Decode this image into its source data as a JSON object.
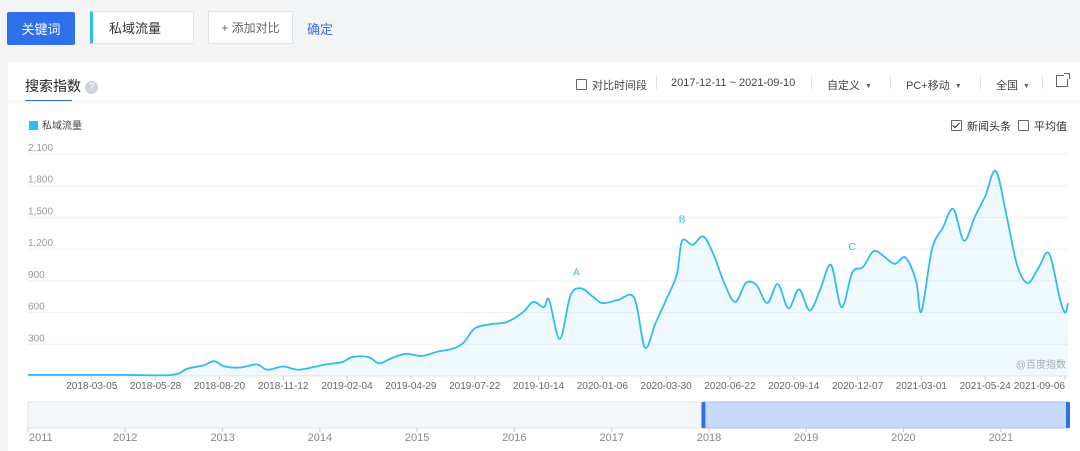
{
  "toolbar": {
    "keyword_button": "关键词",
    "keyword_value": "私域流量",
    "add_compare": "+ 添加对比",
    "confirm": "确定"
  },
  "panel": {
    "title": "搜索指数",
    "help_icon": "question-circle-icon",
    "compare_period_label": "对比时间段",
    "compare_period_checked": false,
    "date_range": "2017-12-11 ~ 2021-09-10",
    "custom_label": "自定义",
    "device_label": "PC+移动",
    "region_label": "全国",
    "export_icon": "external-link-icon",
    "news_headline_label": "新闻头条",
    "news_headline_checked": true,
    "average_label": "平均值",
    "average_checked": false,
    "watermark": "@百度指数"
  },
  "colors": {
    "accent": "#2f6fe9",
    "series": "#2ebdf3",
    "link": "#3370ff"
  },
  "chart_data": {
    "type": "area",
    "title": "",
    "xlabel": "",
    "ylabel": "",
    "ylim": [
      0,
      2100
    ],
    "y_ticks": [
      300,
      600,
      900,
      1200,
      1500,
      1800,
      2100
    ],
    "y_tick_labels": [
      "300",
      "600",
      "900",
      "1,200",
      "1,500",
      "1,800",
      "2,100"
    ],
    "x_range": [
      "2017-12-11",
      "2021-09-10"
    ],
    "x_tick_labels": [
      "2018-03-05",
      "2018-05-28",
      "2018-08-20",
      "2018-11-12",
      "2019-02-04",
      "2019-04-29",
      "2019-07-22",
      "2019-10-14",
      "2020-01-06",
      "2020-03-30",
      "2020-06-22",
      "2020-09-14",
      "2020-12-07",
      "2021-03-01",
      "2021-05-24",
      "2021-09-06"
    ],
    "legend": [
      "私域流量"
    ],
    "legend_position": "top-left",
    "grid": true,
    "annotations": [
      {
        "label": "A",
        "x": "2019-12-03",
        "y": 820
      },
      {
        "label": "B",
        "x": "2020-04-20",
        "y": 1320
      },
      {
        "label": "C",
        "x": "2020-11-30",
        "y": 1060
      }
    ],
    "series": [
      {
        "name": "私域流量",
        "points": [
          [
            "2017-12-11",
            10
          ],
          [
            "2018-02-12",
            10
          ],
          [
            "2018-04-16",
            10
          ],
          [
            "2018-06-18",
            10
          ],
          [
            "2018-07-09",
            70
          ],
          [
            "2018-07-30",
            100
          ],
          [
            "2018-08-13",
            140
          ],
          [
            "2018-08-27",
            90
          ],
          [
            "2018-09-17",
            80
          ],
          [
            "2018-10-08",
            110
          ],
          [
            "2018-10-22",
            60
          ],
          [
            "2018-11-12",
            90
          ],
          [
            "2018-12-03",
            60
          ],
          [
            "2019-01-07",
            110
          ],
          [
            "2019-01-28",
            130
          ],
          [
            "2019-02-11",
            180
          ],
          [
            "2019-03-04",
            180
          ],
          [
            "2019-03-18",
            120
          ],
          [
            "2019-04-01",
            160
          ],
          [
            "2019-04-22",
            210
          ],
          [
            "2019-05-13",
            190
          ],
          [
            "2019-06-03",
            230
          ],
          [
            "2019-06-24",
            260
          ],
          [
            "2019-07-08",
            320
          ],
          [
            "2019-07-22",
            450
          ],
          [
            "2019-08-12",
            490
          ],
          [
            "2019-09-02",
            510
          ],
          [
            "2019-09-23",
            600
          ],
          [
            "2019-10-07",
            700
          ],
          [
            "2019-10-21",
            650
          ],
          [
            "2019-10-28",
            720
          ],
          [
            "2019-11-11",
            350
          ],
          [
            "2019-11-25",
            760
          ],
          [
            "2019-12-09",
            830
          ],
          [
            "2019-12-23",
            760
          ],
          [
            "2020-01-06",
            690
          ],
          [
            "2020-01-27",
            720
          ],
          [
            "2020-02-17",
            740
          ],
          [
            "2020-03-02",
            270
          ],
          [
            "2020-03-16",
            500
          ],
          [
            "2020-03-30",
            720
          ],
          [
            "2020-04-13",
            960
          ],
          [
            "2020-04-20",
            1280
          ],
          [
            "2020-05-04",
            1240
          ],
          [
            "2020-05-18",
            1320
          ],
          [
            "2020-06-01",
            1140
          ],
          [
            "2020-06-15",
            870
          ],
          [
            "2020-06-29",
            700
          ],
          [
            "2020-07-13",
            880
          ],
          [
            "2020-07-27",
            860
          ],
          [
            "2020-08-10",
            690
          ],
          [
            "2020-08-24",
            870
          ],
          [
            "2020-09-07",
            640
          ],
          [
            "2020-09-21",
            820
          ],
          [
            "2020-10-05",
            620
          ],
          [
            "2020-10-19",
            820
          ],
          [
            "2020-11-02",
            1050
          ],
          [
            "2020-11-16",
            650
          ],
          [
            "2020-11-30",
            980
          ],
          [
            "2020-12-14",
            1030
          ],
          [
            "2020-12-28",
            1180
          ],
          [
            "2021-01-11",
            1130
          ],
          [
            "2021-01-25",
            1060
          ],
          [
            "2021-02-08",
            1120
          ],
          [
            "2021-02-22",
            900
          ],
          [
            "2021-03-01",
            610
          ],
          [
            "2021-03-15",
            1200
          ],
          [
            "2021-03-29",
            1400
          ],
          [
            "2021-04-12",
            1580
          ],
          [
            "2021-04-26",
            1280
          ],
          [
            "2021-05-10",
            1500
          ],
          [
            "2021-05-24",
            1700
          ],
          [
            "2021-06-07",
            1940
          ],
          [
            "2021-06-21",
            1520
          ],
          [
            "2021-07-05",
            1050
          ],
          [
            "2021-07-19",
            880
          ],
          [
            "2021-08-02",
            1020
          ],
          [
            "2021-08-16",
            1160
          ],
          [
            "2021-08-30",
            740
          ],
          [
            "2021-09-06",
            600
          ],
          [
            "2021-09-10",
            690
          ]
        ]
      }
    ]
  },
  "navigator": {
    "year_labels": [
      "2011",
      "2012",
      "2013",
      "2014",
      "2015",
      "2016",
      "2017",
      "2018",
      "2019",
      "2020",
      "2021"
    ],
    "selected_range": [
      "2017-12-11",
      "2021-09-10"
    ]
  }
}
